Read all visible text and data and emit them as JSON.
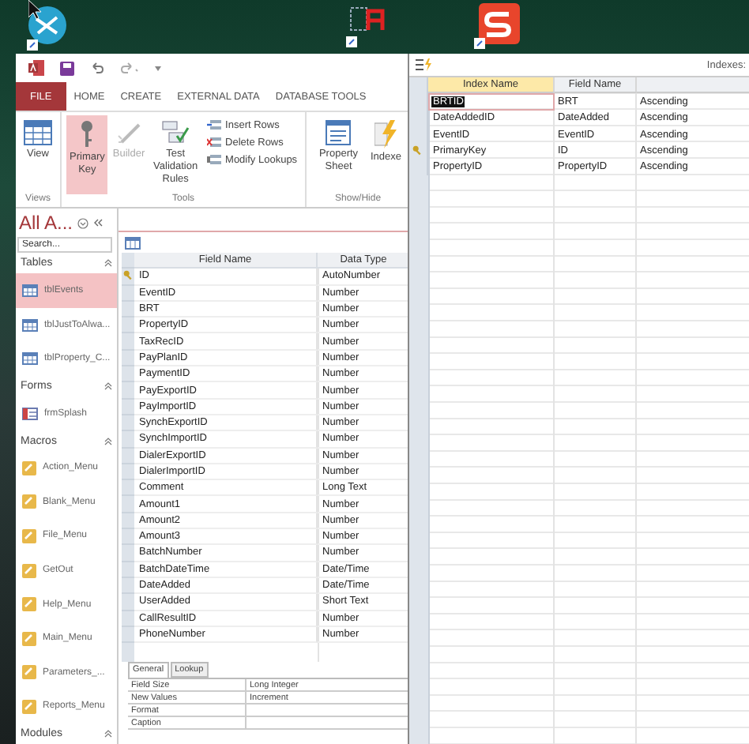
{
  "ribbon": {
    "tabs": [
      {
        "label": "FILE",
        "kind": "file"
      },
      {
        "label": "HOME",
        "kind": "tab"
      },
      {
        "label": "CREATE",
        "kind": "tab"
      },
      {
        "label": "EXTERNAL DATA",
        "kind": "tab"
      },
      {
        "label": "DATABASE TOOLS",
        "kind": "tab"
      }
    ],
    "groups": [
      {
        "label": "Views",
        "buttons": [
          {
            "label": "View",
            "on": false,
            "disabled": false
          }
        ]
      },
      {
        "label": "Tools",
        "buttons": [
          {
            "label": "Primary Key",
            "on": true,
            "disabled": false
          },
          {
            "label": "Builder",
            "on": false,
            "disabled": true
          },
          {
            "label": "Test Validation Rules",
            "on": false,
            "disabled": false
          }
        ],
        "small": [
          {
            "label": "Insert Rows"
          },
          {
            "label": "Delete Rows"
          },
          {
            "label": "Modify Lookups"
          }
        ]
      },
      {
        "label": "Show/Hide",
        "buttons": [
          {
            "label": "Property Sheet",
            "on": false,
            "disabled": false
          },
          {
            "label": "Indexe",
            "on": false,
            "disabled": false
          }
        ]
      }
    ]
  },
  "navigation": {
    "title": "All A...",
    "search": {
      "placeholder": "Search..."
    },
    "groups": [
      {
        "label": "Tables",
        "kind": "table",
        "items": [
          {
            "label": "tblEvents",
            "selected": true
          },
          {
            "label": "tblJustToAlwa...",
            "selected": false
          },
          {
            "label": "tblProperty_C...",
            "selected": false
          }
        ]
      },
      {
        "label": "Forms",
        "kind": "form",
        "items": [
          {
            "label": "frmSplash",
            "selected": false
          }
        ]
      },
      {
        "label": "Macros",
        "kind": "macro",
        "items": [
          {
            "label": "Action_Menu",
            "selected": false
          },
          {
            "label": "Blank_Menu",
            "selected": false
          },
          {
            "label": "File_Menu",
            "selected": false
          },
          {
            "label": "GetOut",
            "selected": false
          },
          {
            "label": "Help_Menu",
            "selected": false
          },
          {
            "label": "Main_Menu",
            "selected": false
          },
          {
            "label": "Parameters_...",
            "selected": false
          },
          {
            "label": "Reports_Menu",
            "selected": false
          }
        ]
      },
      {
        "label": "Modules"
      }
    ]
  },
  "table_design": {
    "columns": [
      "Field Name",
      "Data Type"
    ],
    "fields": [
      {
        "name": "ID",
        "type": "AutoNumber",
        "primary_key": true
      },
      {
        "name": "EventID",
        "type": "Number",
        "primary_key": false
      },
      {
        "name": "BRT",
        "type": "Number",
        "primary_key": false
      },
      {
        "name": "PropertyID",
        "type": "Number",
        "primary_key": false
      },
      {
        "name": "TaxRecID",
        "type": "Number",
        "primary_key": false
      },
      {
        "name": "PayPlanID",
        "type": "Number",
        "primary_key": false
      },
      {
        "name": "PaymentID",
        "type": "Number",
        "primary_key": false
      },
      {
        "name": "PayExportID",
        "type": "Number",
        "primary_key": false
      },
      {
        "name": "PayImportID",
        "type": "Number",
        "primary_key": false
      },
      {
        "name": "SynchExportID",
        "type": "Number",
        "primary_key": false
      },
      {
        "name": "SynchImportID",
        "type": "Number",
        "primary_key": false
      },
      {
        "name": "DialerExportID",
        "type": "Number",
        "primary_key": false
      },
      {
        "name": "DialerImportID",
        "type": "Number",
        "primary_key": false
      },
      {
        "name": "Comment",
        "type": "Long Text",
        "primary_key": false
      },
      {
        "name": "Amount1",
        "type": "Number",
        "primary_key": false
      },
      {
        "name": "Amount2",
        "type": "Number",
        "primary_key": false
      },
      {
        "name": "Amount3",
        "type": "Number",
        "primary_key": false
      },
      {
        "name": "BatchNumber",
        "type": "Number",
        "primary_key": false
      },
      {
        "name": "BatchDateTime",
        "type": "Date/Time",
        "primary_key": false
      },
      {
        "name": "DateAdded",
        "type": "Date/Time",
        "primary_key": false
      },
      {
        "name": "UserAdded",
        "type": "Short Text",
        "primary_key": false
      },
      {
        "name": "CallResultID",
        "type": "Number",
        "primary_key": false
      },
      {
        "name": "PhoneNumber",
        "type": "Number",
        "primary_key": false
      }
    ],
    "property_tabs": [
      {
        "label": "General",
        "selected": true
      },
      {
        "label": "Lookup",
        "selected": false
      }
    ],
    "properties": [
      {
        "name": "Field Size",
        "value": "Long Integer"
      },
      {
        "name": "New Values",
        "value": "Increment"
      },
      {
        "name": "Format"
      },
      {
        "name": "Caption"
      }
    ]
  },
  "indexes_dialog": {
    "title": "Indexes:",
    "columns": [
      "Index Name",
      "Field Name"
    ],
    "rows": [
      {
        "index_name": "BRTID",
        "field_name": "BRT",
        "sort_order": "Ascending",
        "primary_key": false,
        "selected": true
      },
      {
        "index_name": "DateAddedID",
        "field_name": "DateAdded",
        "sort_order": "Ascending",
        "primary_key": false,
        "selected": false
      },
      {
        "index_name": "EventID",
        "field_name": "EventID",
        "sort_order": "Ascending",
        "primary_key": false,
        "selected": false
      },
      {
        "index_name": "PrimaryKey",
        "field_name": "ID",
        "sort_order": "Ascending",
        "primary_key": true,
        "selected": false
      },
      {
        "index_name": "PropertyID",
        "field_name": "PropertyID",
        "sort_order": "Ascending",
        "primary_key": false,
        "selected": false
      }
    ]
  }
}
